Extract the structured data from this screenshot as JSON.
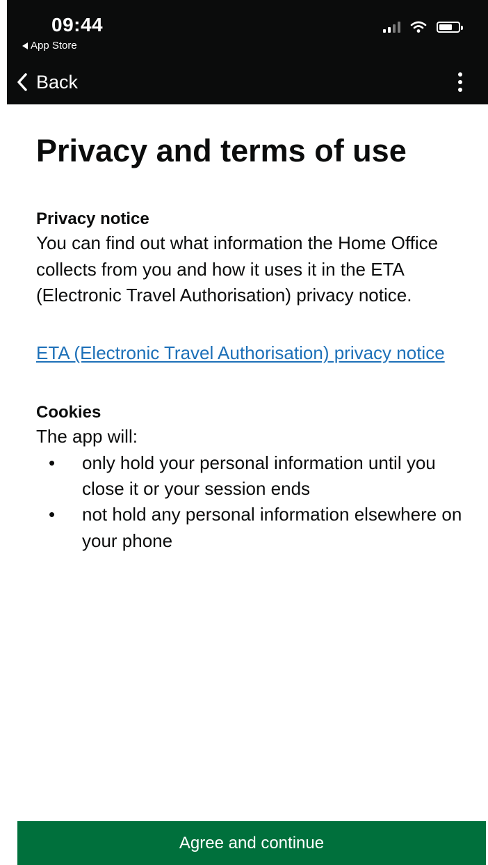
{
  "status_bar": {
    "time": "09:44",
    "back_app": "App Store"
  },
  "nav": {
    "back_label": "Back"
  },
  "page": {
    "title": "Privacy and terms of use",
    "privacy": {
      "heading": "Privacy notice",
      "body": "You can find out what information the Home Office collects from you and how it uses it in the ETA (Electronic Travel Authorisation) privacy notice.",
      "link": "ETA (Electronic Travel Authorisation) privacy notice"
    },
    "cookies": {
      "heading": "Cookies",
      "intro": "The app will:",
      "items": [
        "only hold your personal information until you close it or your session ends",
        "not hold any personal information elsewhere on your phone"
      ]
    }
  },
  "footer": {
    "button_label": "Agree and continue"
  },
  "colors": {
    "header_bg": "#0b0c0c",
    "link": "#1d70b8",
    "primary_button": "#00703c"
  }
}
